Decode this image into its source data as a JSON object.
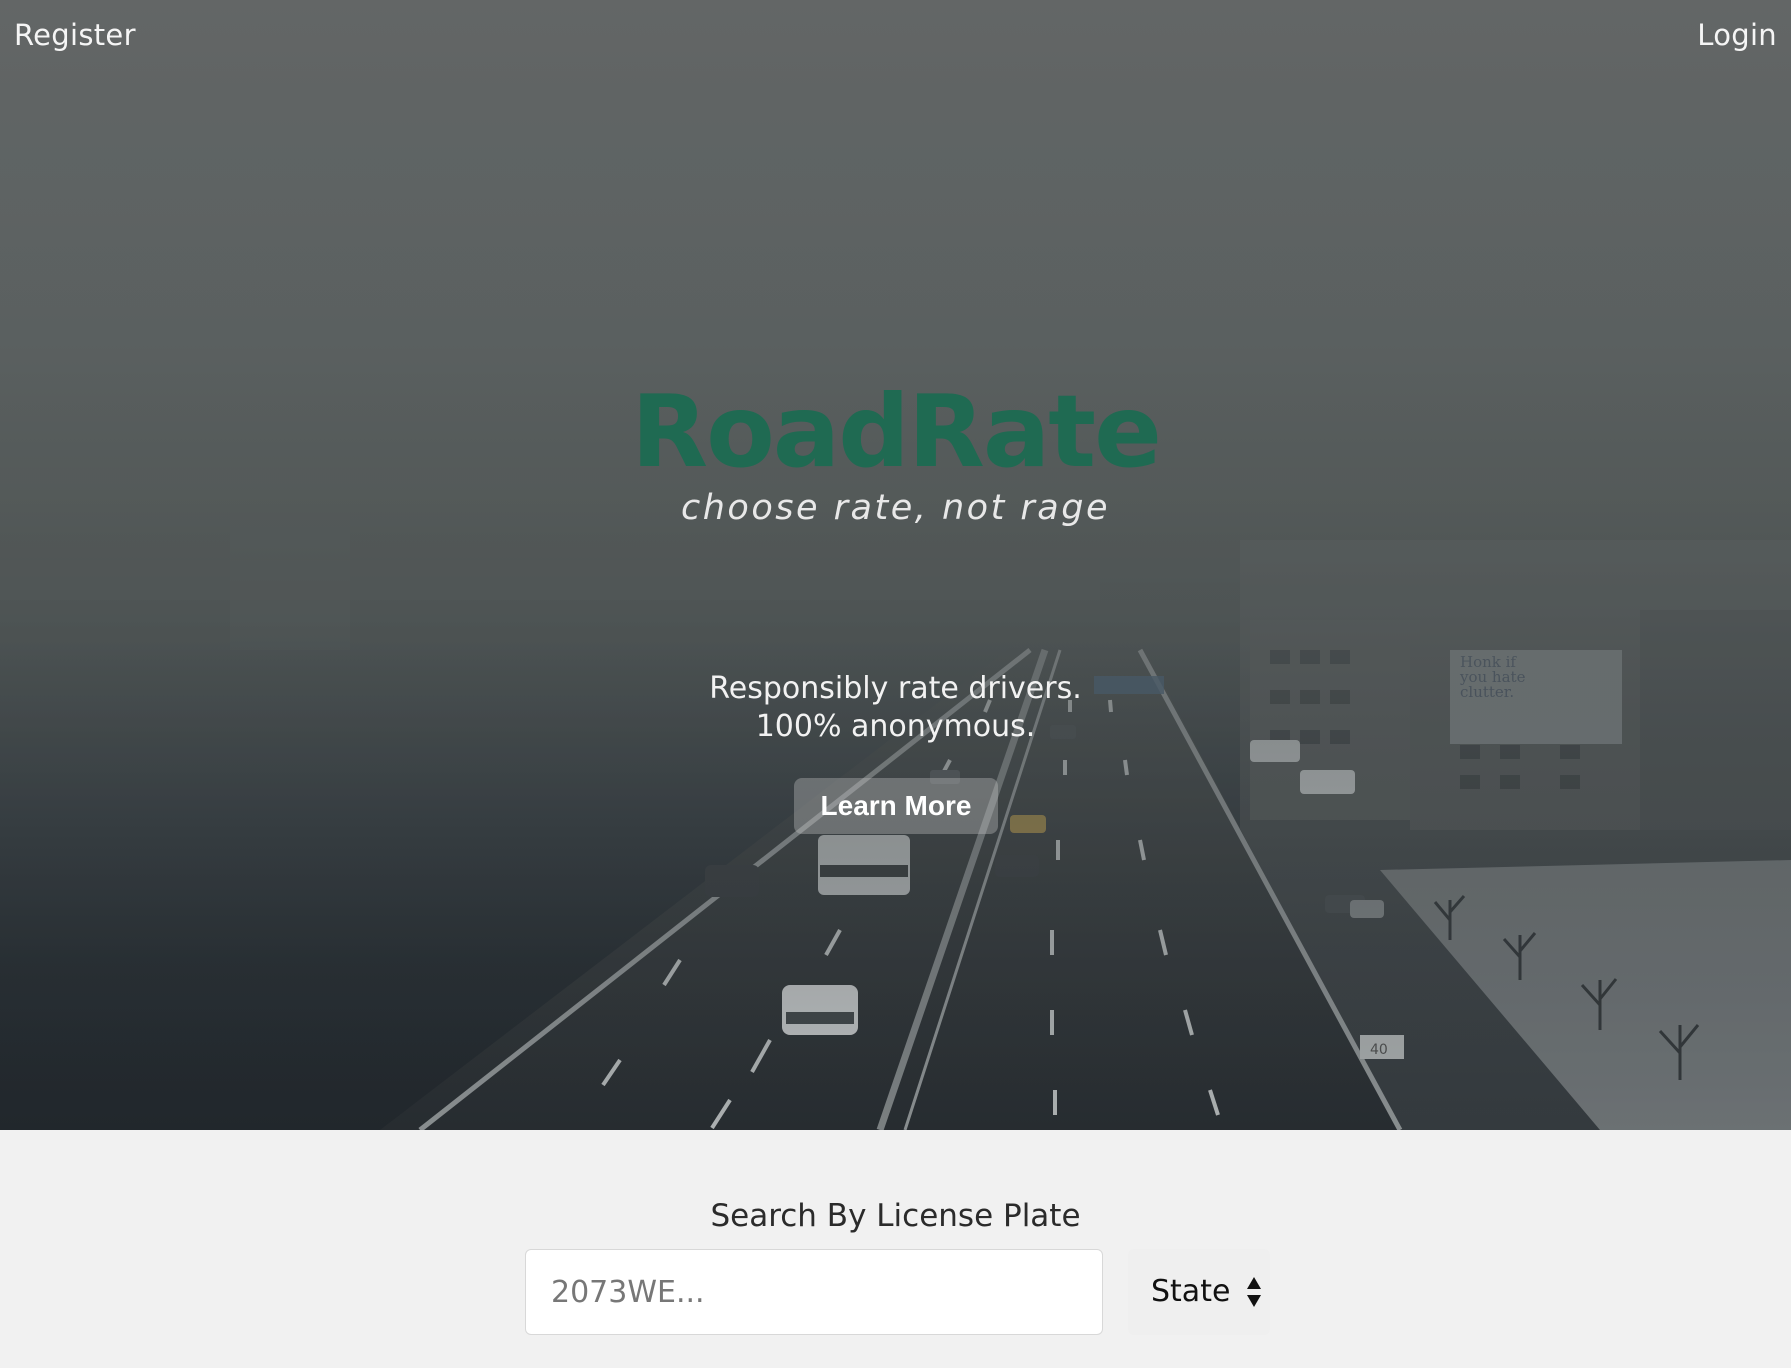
{
  "nav": {
    "register_label": "Register",
    "login_label": "Login"
  },
  "hero": {
    "brand": "RoadRate",
    "tagline": "choose rate, not rage",
    "blurb_line1": "Responsibly rate drivers.",
    "blurb_line2": "100% anonymous.",
    "learn_more_label": "Learn More",
    "billboard_text": [
      "Honk if",
      "you hate",
      "clutter."
    ],
    "sign_text": "40"
  },
  "search": {
    "title": "Search By License Plate",
    "plate_placeholder": "2073WE...",
    "state_label": "State"
  },
  "colors": {
    "brand": "#1f6a52",
    "search_bg": "#f1f1f1"
  },
  "icons": {
    "state_select": "sort-arrows-icon"
  }
}
